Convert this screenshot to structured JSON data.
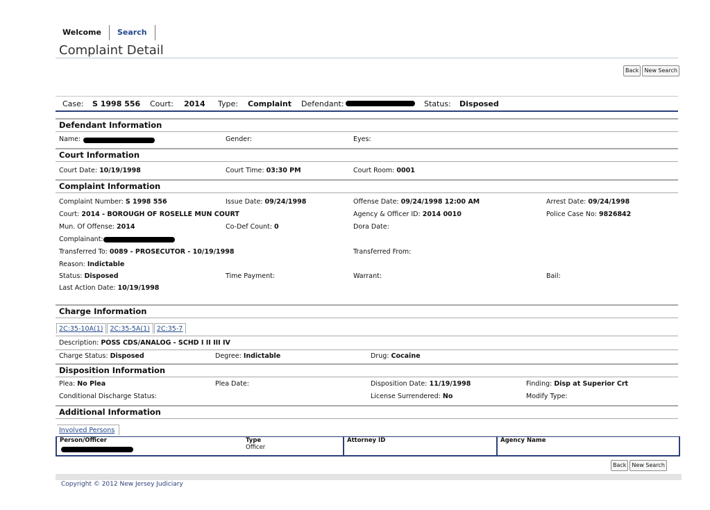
{
  "nav": {
    "welcome": "Welcome",
    "search": "Search"
  },
  "page_title": "Complaint Detail",
  "buttons": {
    "back": "Back",
    "new_search": "New Search"
  },
  "case": {
    "case_label": "Case:",
    "case_value": "S 1998 556",
    "court_label": "Court:",
    "court_value": "2014",
    "type_label": "Type:",
    "type_value": "Complaint",
    "defendant_label": "Defendant:",
    "status_label": "Status:",
    "status_value": "Disposed"
  },
  "defendant": {
    "heading": "Defendant Information",
    "name_label": "Name:",
    "gender_label": "Gender:",
    "eyes_label": "Eyes:"
  },
  "court": {
    "heading": "Court Information",
    "date_label": "Court Date:",
    "date_value": "10/19/1998",
    "time_label": "Court Time:",
    "time_value": "03:30 PM",
    "room_label": "Court Room:",
    "room_value": "0001"
  },
  "complaint": {
    "heading": "Complaint Information",
    "number_label": "Complaint Number:",
    "number_value": "S 1998 556",
    "issue_label": "Issue Date:",
    "issue_value": "09/24/1998",
    "offense_label": "Offense Date:",
    "offense_value": "09/24/1998 12:00 AM",
    "arrest_label": "Arrest Date:",
    "arrest_value": "09/24/1998",
    "court_label": "Court:",
    "court_value": "2014 - BOROUGH OF ROSELLE MUN COURT",
    "agency_label": "Agency & Officer ID:",
    "agency_value": "2014 0010",
    "police_label": "Police Case No:",
    "police_value": "9826842",
    "mun_label": "Mun. Of Offense:",
    "mun_value": "2014",
    "codef_label": "Co-Def Count:",
    "codef_value": "0",
    "dora_label": "Dora Date:",
    "complainant_label": "Complainant:",
    "transferred_to_label": "Transferred To:",
    "transferred_to_value": "0089 - PROSECUTOR - 10/19/1998",
    "transferred_from_label": "Transferred From:",
    "reason_label": "Reason:",
    "reason_value": "Indictable",
    "status_label": "Status:",
    "status_value": "Disposed",
    "time_payment_label": "Time Payment:",
    "warrant_label": "Warrant:",
    "bail_label": "Bail:",
    "last_action_label": "Last Action Date:",
    "last_action_value": "10/19/1998"
  },
  "charge": {
    "heading": "Charge Information",
    "tabs": [
      "2C:35-10A(1)",
      "2C:35-5A(1)",
      "2C:35-7"
    ],
    "description_label": "Description:",
    "description_value": "POSS CDS/ANALOG - SCHD I II III IV",
    "status_label": "Charge Status:",
    "status_value": "Disposed",
    "degree_label": "Degree:",
    "degree_value": "Indictable",
    "drug_label": "Drug:",
    "drug_value": "Cocaine"
  },
  "disposition": {
    "heading": "Disposition Information",
    "plea_label": "Plea:",
    "plea_value": "No Plea",
    "plea_date_label": "Plea Date:",
    "disp_date_label": "Disposition Date:",
    "disp_date_value": "11/19/1998",
    "finding_label": "Finding:",
    "finding_value": "Disp at Superior Crt",
    "cond_label": "Conditional Discharge Status:",
    "license_label": "License Surrendered:",
    "license_value": "No",
    "modify_label": "Modify Type:"
  },
  "additional": {
    "heading": "Additional Information",
    "tab": "Involved Persons",
    "columns": [
      "Person/Officer",
      "Type",
      "Attorney ID",
      "Agency Name"
    ],
    "row_type": "Officer"
  },
  "footer": "Copyright © 2012 New Jersey Judiciary"
}
